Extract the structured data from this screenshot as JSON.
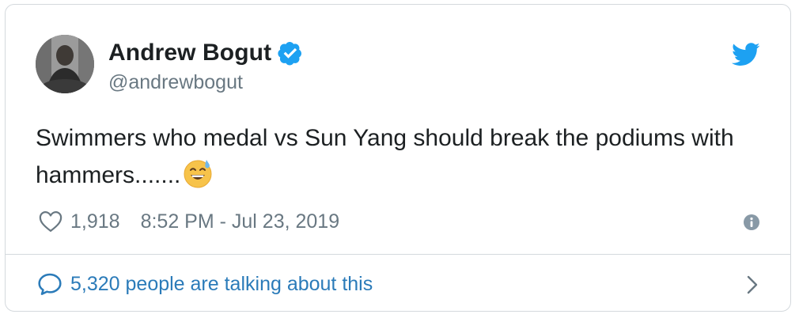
{
  "author": {
    "display_name": "Andrew Bogut",
    "handle": "@andrewbogut",
    "verified": true
  },
  "tweet": {
    "text": "Swimmers who medal vs Sun Yang should break the podiums with hammers.......",
    "emoji": "grinning-face-with-sweat"
  },
  "meta": {
    "likes": "1,918",
    "timestamp": "8:52 PM - Jul 23, 2019"
  },
  "footer": {
    "talking": "5,320 people are talking about this"
  },
  "colors": {
    "text": "#1c2022",
    "secondary": "#697882",
    "link": "#2b7bb9",
    "twitter_blue": "#1da1f2",
    "border": "#d4d9dd"
  },
  "icons": [
    "avatar",
    "verified-badge-icon",
    "twitter-bird-icon",
    "heart-icon",
    "info-icon",
    "speech-bubble-icon",
    "chevron-right-icon"
  ]
}
